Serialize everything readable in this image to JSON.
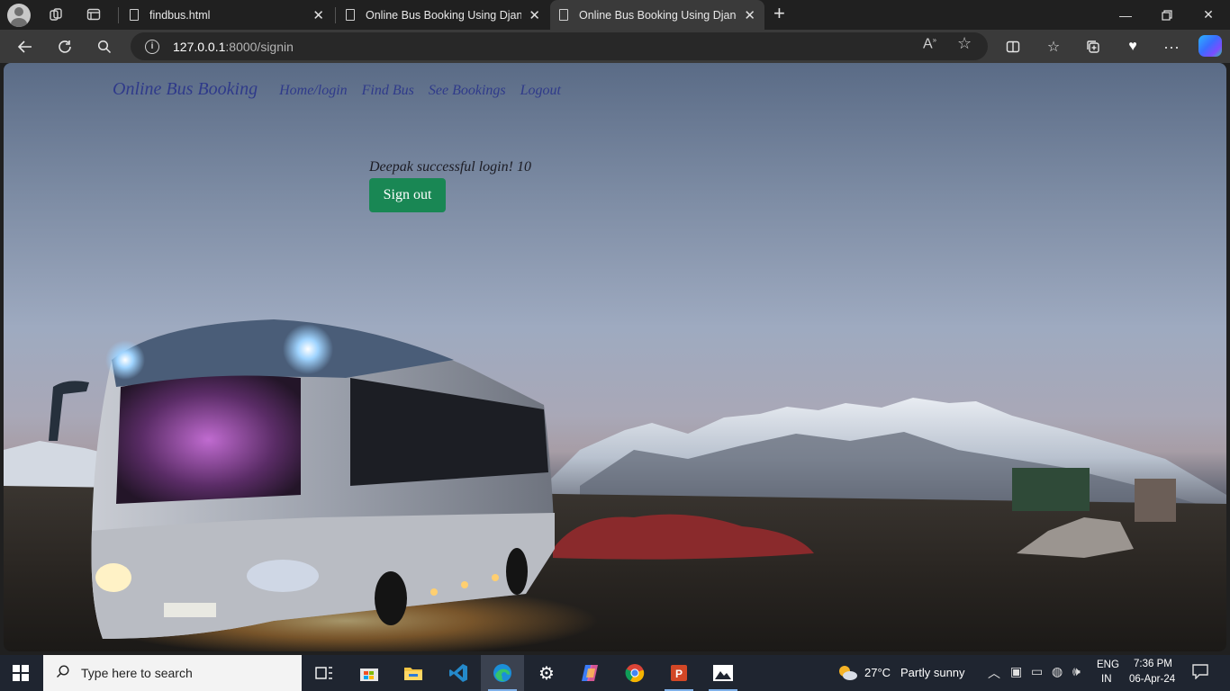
{
  "browser": {
    "tabs": [
      {
        "title": "findbus.html",
        "active": false
      },
      {
        "title": "Online Bus Booking Using Django",
        "active": false
      },
      {
        "title": "Online Bus Booking Using Django",
        "active": true
      }
    ],
    "address": {
      "host": "127.0.0.1",
      "path": ":8000/signin"
    },
    "icons": [
      "profile-icon",
      "workspaces-icon",
      "tab-actions-icon",
      "back-icon",
      "refresh-icon",
      "search-icon",
      "info-icon",
      "read-aloud-icon",
      "favorite-star-icon",
      "split-screen-icon",
      "favorites-icon",
      "collections-icon",
      "browser-essentials-icon",
      "more-icon",
      "copilot-icon"
    ]
  },
  "site": {
    "brand": "Online Bus Booking",
    "nav": [
      {
        "label": "Home/login"
      },
      {
        "label": "Find Bus"
      },
      {
        "label": "See Bookings"
      },
      {
        "label": "Logout"
      }
    ],
    "message": "Deepak successful login! 10",
    "signout_label": "Sign out",
    "signout_color": "#198754",
    "link_color": "#2f3a8a"
  },
  "taskbar": {
    "search_placeholder": "Type here to search",
    "apps": [
      "task-view-icon",
      "store-icon",
      "file-explorer-icon",
      "vscode-icon",
      "edge-icon",
      "settings-icon",
      "copilot-icon",
      "chrome-icon",
      "powerpoint-icon",
      "photos-icon"
    ],
    "weather": {
      "temp": "27°C",
      "condition": "Partly sunny"
    },
    "lang": {
      "code": "ENG",
      "region": "IN"
    },
    "clock": {
      "time": "7:36 PM",
      "date": "06-Apr-24"
    }
  }
}
